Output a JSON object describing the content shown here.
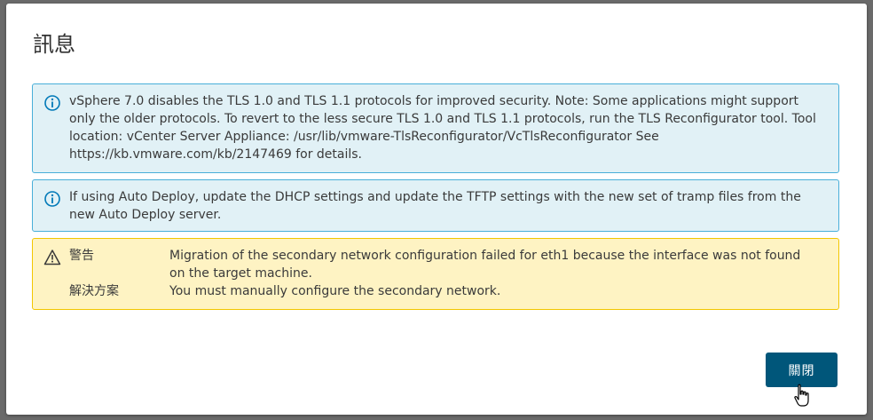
{
  "dialog": {
    "title": "訊息",
    "close_button": "關閉"
  },
  "alerts": [
    {
      "type": "info",
      "icon": "info-circle-icon",
      "text": "vSphere 7.0 disables the TLS 1.0 and TLS 1.1 protocols for improved security. Note: Some applications might support only the older protocols. To revert to the less secure TLS 1.0 and TLS 1.1 protocols, run the TLS Reconfigurator tool. Tool location: vCenter Server Appliance: /usr/lib/vmware-TlsReconfigurator/VcTlsReconfigurator See https://kb.vmware.com/kb/2147469 for details."
    },
    {
      "type": "info",
      "icon": "info-circle-icon",
      "text": "If using Auto Deploy, update the DHCP settings and update the TFTP settings with the new set of tramp files from the new Auto Deploy server."
    },
    {
      "type": "warning",
      "icon": "warning-triangle-icon",
      "warning_label": "警告",
      "warning_text": "Migration of the secondary network configuration failed for eth1 because the interface was not found on the target machine.",
      "resolution_label": "解決方案",
      "resolution_text": "You must manually configure the secondary network."
    }
  ],
  "colors": {
    "info_bg": "#e1f1f6",
    "info_border": "#49afd9",
    "warning_bg": "#fef3c3",
    "warning_border": "#f2c600",
    "primary_button": "#00567a"
  }
}
